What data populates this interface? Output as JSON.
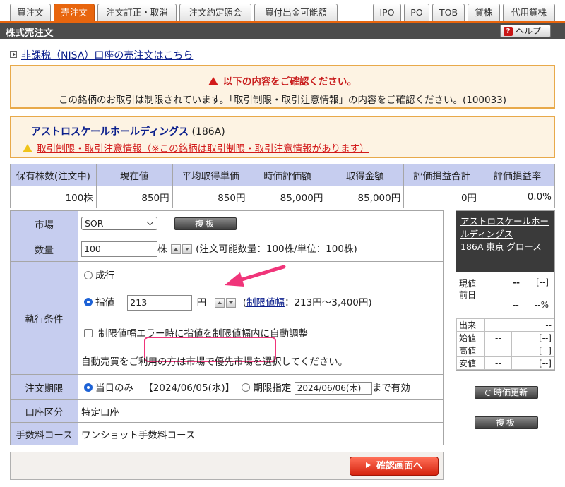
{
  "tabs": {
    "left": [
      "買注文",
      "売注文",
      "注文訂正・取消",
      "注文約定照会",
      "買付出金可能額"
    ],
    "right": [
      "IPO",
      "PO",
      "TOB",
      "貸株",
      "代用貸株"
    ],
    "active": "売注文"
  },
  "header": {
    "title": "株式売注文",
    "help_label": "ヘルプ",
    "help_icon": "?"
  },
  "nisa_link": "非課税（NISA）口座の売注文はこちら",
  "warning": {
    "title": "以下の内容をご確認ください。",
    "message": "この銘柄のお取引は制限されています。「取引制限・取引注意情報」の内容をご確認ください。(100033)"
  },
  "stock": {
    "name": "アストロスケールホールディングス",
    "code": "(186A)",
    "restriction_link": "取引制限・取引注意情報（※この銘柄は取引制限・取引注意情報があります）"
  },
  "holdings": {
    "headers": [
      "保有株数(注文中)",
      "現在値",
      "平均取得単価",
      "時価評価額",
      "取得金額",
      "評価損益合計",
      "評価損益率"
    ],
    "values": [
      "100株",
      "850円",
      "850円",
      "85,000円",
      "85,000円",
      "0円",
      "0.0%"
    ]
  },
  "form": {
    "market": {
      "label": "市場",
      "value": "SOR",
      "button": "複板"
    },
    "quantity": {
      "label": "数量",
      "value": "100",
      "unit": "株",
      "note": "(注文可能数量：100株/単位：100株)"
    },
    "exec": {
      "label": "執行条件",
      "market_order": "成行",
      "limit_order": "指値",
      "limit_value": "213",
      "limit_unit": "円",
      "range_link": "制限値幅",
      "range_text": "：213円〜3,400円)",
      "range_prefix": "(",
      "auto_adjust": "制限値幅エラー時に指値を制限値幅内に自動調整",
      "auto_note": "自動売買をご利用の方は市場で優先市場を選択してください。"
    },
    "period": {
      "label": "注文期限",
      "today": "当日のみ",
      "today_date": "【2024/06/05(水)】",
      "specify": "期限指定",
      "date_value": "2024/06/06(木)",
      "until": "まで有効"
    },
    "account": {
      "label": "口座区分",
      "value": "特定口座"
    },
    "fee": {
      "label": "手数料コース",
      "value": "ワンショット手数料コース"
    }
  },
  "submit_label": "確認画面へ",
  "quote": {
    "name": "アストロスケールホールディングス",
    "code_line": "186A 東京 グロース",
    "current_label": "現値",
    "current_value": "--",
    "current_bracket": "[--]",
    "prev_label": "前日",
    "prev_value": "--",
    "change_value": "--",
    "change_pct": "--%",
    "rows": [
      {
        "label": "出来",
        "value": "",
        "bracket": "--"
      },
      {
        "label": "始値",
        "value": "--",
        "bracket": "[--]"
      },
      {
        "label": "高値",
        "value": "--",
        "bracket": "[--]"
      },
      {
        "label": "安値",
        "value": "--",
        "bracket": "[--]"
      }
    ],
    "refresh_label": "時価更新",
    "board_label": "複板"
  },
  "colors": {
    "accent": "#e8650d",
    "annotation": "#f0357a",
    "header_bg": "#c6cdef"
  }
}
